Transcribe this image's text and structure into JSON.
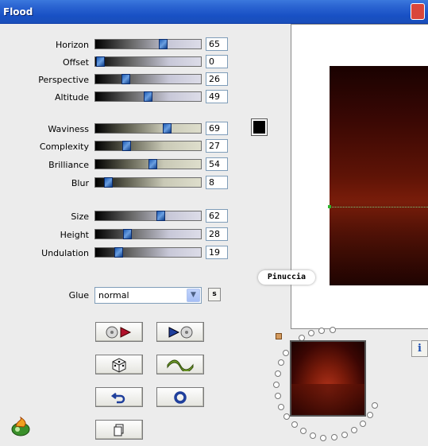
{
  "window": {
    "title": "Flood"
  },
  "sliders_group1": [
    {
      "label": "Horizon",
      "value": "65",
      "pos": 65
    },
    {
      "label": "Offset",
      "value": "0",
      "pos": 0
    },
    {
      "label": "Perspective",
      "value": "26",
      "pos": 26
    },
    {
      "label": "Altitude",
      "value": "49",
      "pos": 49
    }
  ],
  "sliders_group2": [
    {
      "label": "Waviness",
      "value": "69",
      "pos": 69
    },
    {
      "label": "Complexity",
      "value": "27",
      "pos": 27
    },
    {
      "label": "Brilliance",
      "value": "54",
      "pos": 54
    },
    {
      "label": "Blur",
      "value": "8",
      "pos": 8
    }
  ],
  "sliders_group3": [
    {
      "label": "Size",
      "value": "62",
      "pos": 62
    },
    {
      "label": "Height",
      "value": "28",
      "pos": 28
    },
    {
      "label": "Undulation",
      "value": "19",
      "pos": 19
    }
  ],
  "color_swatch": "#000000",
  "glue": {
    "label": "Glue",
    "value": "normal",
    "s_label": "s"
  },
  "preview": {
    "watermark": "Pinuccia"
  },
  "info_label": "i",
  "icons": {
    "load": "disc-arrow-in-icon",
    "save": "arrow-disc-out-icon",
    "random": "dice-icon",
    "wave": "wave-icon",
    "undo": "undo-arrow-icon",
    "reset": "ring-icon",
    "copy": "copy-pages-icon",
    "logo": "flaming-star-logo"
  }
}
